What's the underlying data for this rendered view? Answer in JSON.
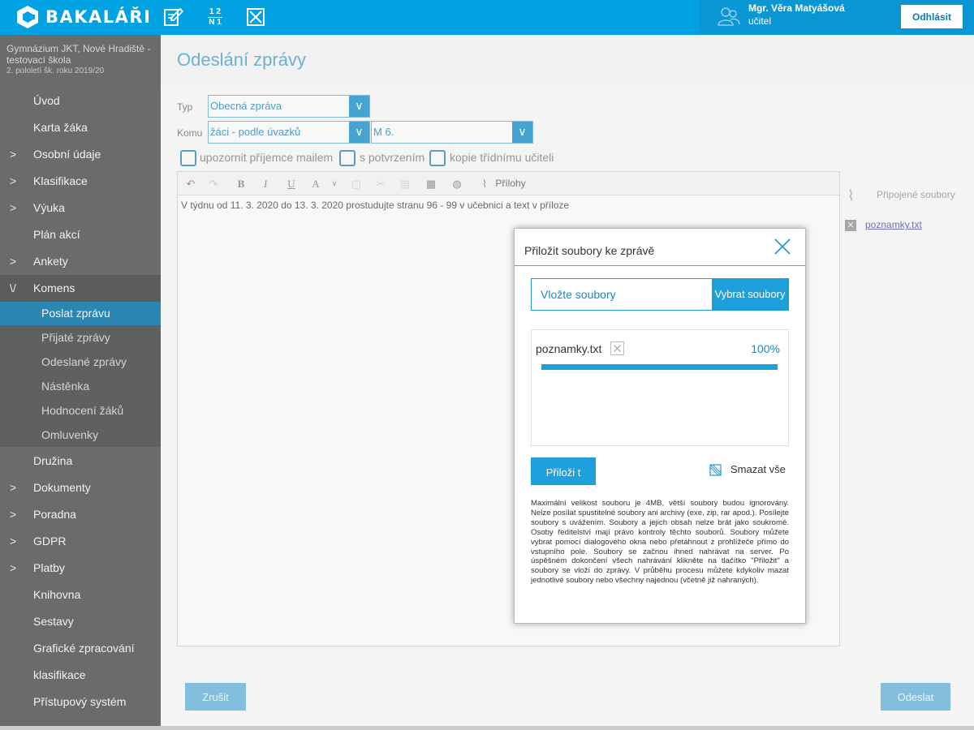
{
  "app": {
    "name": "BAKALÁŘI"
  },
  "topbar": {
    "icons": [
      "grades-notebook-icon",
      "fraction-icon",
      "absence-icon"
    ],
    "fraction_top": "1 2",
    "fraction_bottom": "N 1",
    "user_name": "Mgr. Věra Matyášová",
    "user_role": "učitel",
    "logout_label": "Odhlásit"
  },
  "sidebar": {
    "school_name": "Gymnázium JKT, Nové Hradiště - testovací škola",
    "term": "2. pololetí šk. roku 2019/20",
    "items": [
      {
        "label": "Úvod",
        "chevron": ""
      },
      {
        "label": "Karta žáka",
        "chevron": ""
      },
      {
        "label": "Osobní údaje",
        "chevron": ">"
      },
      {
        "label": "Klasifikace",
        "chevron": ">"
      },
      {
        "label": "Výuka",
        "chevron": ">"
      },
      {
        "label": "Plán akcí",
        "chevron": ""
      },
      {
        "label": "Ankety",
        "chevron": ">"
      },
      {
        "label": "Komens",
        "chevron": "\\/"
      }
    ],
    "sub_items": [
      {
        "label": "Poslat zprávu",
        "active": true
      },
      {
        "label": "Přijaté zprávy",
        "active": false
      },
      {
        "label": "Odeslané zprávy",
        "active": false
      },
      {
        "label": "Nástěnka",
        "active": false
      },
      {
        "label": "Hodnocení žáků",
        "active": false
      },
      {
        "label": "Omluvenky",
        "active": false
      }
    ],
    "items_after": [
      {
        "label": "Družina",
        "chevron": ""
      },
      {
        "label": "Dokumenty",
        "chevron": ">"
      },
      {
        "label": "Poradna",
        "chevron": ">"
      },
      {
        "label": "GDPR",
        "chevron": ">"
      },
      {
        "label": "Platby",
        "chevron": ">"
      },
      {
        "label": "Knihovna",
        "chevron": ""
      },
      {
        "label": "Sestavy",
        "chevron": ""
      },
      {
        "label": "Grafické zpracování",
        "chevron": ""
      },
      {
        "label": "klasifikace",
        "chevron": ""
      },
      {
        "label": "Přístupový systém",
        "chevron": ""
      }
    ]
  },
  "main": {
    "title": "Odeslání zprávy",
    "type_label": "Typ",
    "type_value": "Obecná zpráva",
    "to_label": "Komu",
    "to_value": "žáci - podle úvazků",
    "class_value": "M 6.",
    "options": [
      "upozornit příjemce mailem",
      "s potvrzením",
      "kopie třídnímu učiteli"
    ],
    "toolbar_attachments_label": "Přílohy",
    "editor_text": "V týdnu od 11. 3. 2020 do 13. 3. 2020 prostudujte stranu 96 - 99 v učebnici a text v příloze",
    "attached_files_label": "Připojené soubory",
    "attached_file": "poznamky.txt",
    "cancel_label": "Zrušit",
    "send_label": "Odeslat"
  },
  "modal": {
    "title": "Přiložit soubory ke zprávě",
    "drop_label": "Vložte soubory",
    "pick_label": "Vybrat soubory",
    "file_name": "poznamky.txt",
    "file_progress_text": "100%",
    "file_progress": 1.0,
    "attach_label": "Přiloži t",
    "clear_label": "Smazat vše",
    "info": "Maximální velikost souboru je 4MB, větší soubory budou ignorovány. Nelze posílat spustitelné soubory ani archivy (exe, zip, rar apod.). Posílejte soubory s uvážením. Soubory a jejich obsah nelze brát jako soukromé. Osoby ředitelství mají právo kontroly těchto souborů. Soubory můžete vybrat pomocí dialogového okna nebo přetáhnout z prohlížeče přímo do vstupního pole. Soubory se začnou ihned nahrávat na server. Po úspěšném dokončení všech nahrávání klikněte na tlačítko \"Přiložit\" a soubory se vloží do zprávy. V průběhu procesu můžete kdykoliv mazat jednotlivé soubory nebo všechny najednou (včetně již nahraných)."
  },
  "colors": {
    "accent": "#00a2e2",
    "sidebar": "#6b6b6b",
    "active": "#2a87b4"
  }
}
